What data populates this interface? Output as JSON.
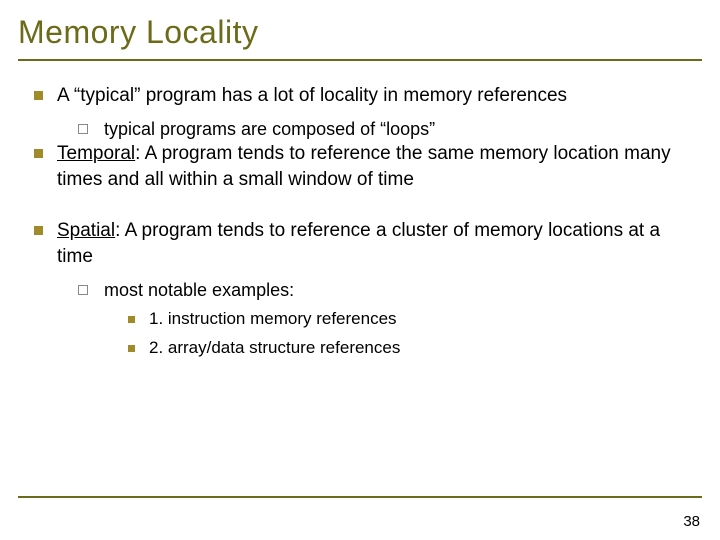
{
  "title": "Memory Locality",
  "bullets": {
    "b1": "A “typical” program has a lot of locality in memory references",
    "b1_sub": "typical programs are composed of “loops”",
    "b2_term": "Temporal",
    "b2_rest": ": A program tends to reference the same memory location many times and all within a small window of time",
    "b3_term": "Spatial",
    "b3_rest": ": A program tends to reference a cluster of memory locations at a time",
    "b3_sub": "most notable examples:",
    "b3_sub_items": {
      "i1": "1. instruction memory references",
      "i2": "2. array/data structure references"
    }
  },
  "page_number": "38"
}
